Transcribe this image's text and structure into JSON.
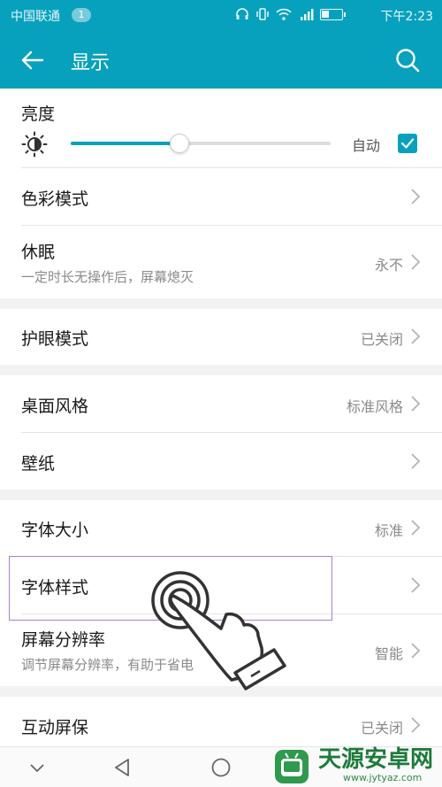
{
  "status_bar": {
    "carrier": "中国联通",
    "badge": "1",
    "time": "下午2:23",
    "icons": [
      "headphones-icon",
      "vibrate-icon",
      "wifi-icon",
      "signal-icon",
      "battery-icon"
    ]
  },
  "app_bar": {
    "title": "显示",
    "back_icon": "back-arrow-icon",
    "search_icon": "search-icon",
    "color": "#08a1bd"
  },
  "brightness": {
    "label": "亮度",
    "level": 0.42,
    "auto_label": "自动",
    "auto_checked": true
  },
  "groups": [
    {
      "items": [
        {
          "label": "色彩模式",
          "value": ""
        },
        {
          "label": "休眠",
          "subtitle": "一定时长无操作后，屏幕熄灭",
          "value": "永不"
        }
      ]
    },
    {
      "items": [
        {
          "label": "护眼模式",
          "value": "已关闭"
        }
      ]
    },
    {
      "items": [
        {
          "label": "桌面风格",
          "value": "标准风格"
        },
        {
          "label": "壁纸",
          "value": ""
        }
      ]
    },
    {
      "items": [
        {
          "label": "字体大小",
          "value": "标准"
        },
        {
          "label": "字体样式",
          "value": ""
        },
        {
          "label": "屏幕分辨率",
          "subtitle": "调节屏幕分辨率，有助于省电",
          "value": "智能"
        }
      ]
    },
    {
      "items": [
        {
          "label": "互动屏保",
          "value": "已关闭"
        }
      ]
    }
  ],
  "nav_bar": {
    "buttons": [
      "down-chevron-icon",
      "back-triangle-icon",
      "home-circle-icon"
    ]
  },
  "watermark": {
    "text": "天源安卓网",
    "url": "www.jytyaz.com"
  }
}
